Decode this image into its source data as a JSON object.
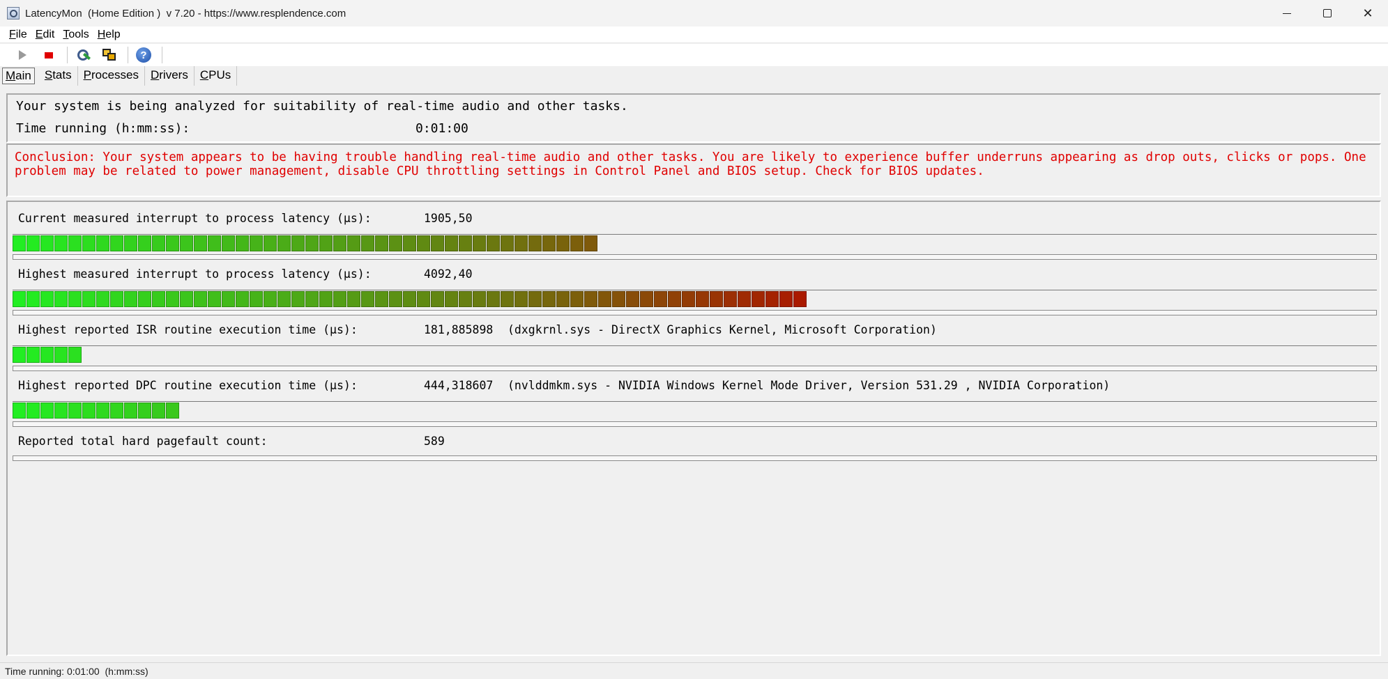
{
  "window": {
    "title": "LatencyMon  (Home Edition )  v 7.20 - https://www.resplendence.com",
    "minimize_icon": "minimize-icon",
    "maximize_icon": "maximize-icon",
    "close_glyph": "✕"
  },
  "menu": {
    "items": [
      "File",
      "Edit",
      "Tools",
      "Help"
    ]
  },
  "toolbar": {
    "icons": [
      "play-icon",
      "stop-icon",
      "wrench-icon",
      "windows-icon",
      "help-icon"
    ],
    "help_glyph": "?"
  },
  "tabs": {
    "items": [
      "Main",
      "Stats",
      "Processes",
      "Drivers",
      "CPUs"
    ],
    "active": "Main"
  },
  "analysis": {
    "status_line": "Your system is being analyzed for suitability of real-time audio and other tasks.",
    "time_label": "Time running (h:mm:ss):",
    "time_value": "0:01:00"
  },
  "conclusion": {
    "text": "Conclusion: Your system appears to be having trouble handling real-time audio and other tasks. You are likely to experience buffer underruns appearing as drop outs, clicks or pops. One problem may be related to power management, disable CPU throttling settings in Control Panel and BIOS setup. Check for BIOS updates.",
    "color": "#e00000"
  },
  "metrics": {
    "max_segments": 98,
    "items": [
      {
        "label": "Current measured interrupt to process latency (µs):",
        "value": "1905,50",
        "extra": "",
        "segments": 42
      },
      {
        "label": "Highest measured interrupt to process latency (µs):",
        "value": "4092,40",
        "extra": "",
        "segments": 57
      },
      {
        "label": "Highest reported ISR routine execution time (µs):",
        "value": "181,885898",
        "extra": "(dxgkrnl.sys - DirectX Graphics Kernel, Microsoft Corporation)",
        "segments": 5
      },
      {
        "label": "Highest reported DPC routine execution time (µs):",
        "value": "444,318607",
        "extra": "(nvlddmkm.sys - NVIDIA Windows Kernel Mode Driver, Version 531.29 , NVIDIA Corporation)",
        "segments": 12
      },
      {
        "label": "Reported total hard pagefault count:",
        "value": "589",
        "extra": "",
        "segments": 0
      }
    ]
  },
  "colors": {
    "meter_low": "#22ee22",
    "meter_mid": "#6a7a10",
    "meter_high": "#aa1a00"
  },
  "statusbar": {
    "text": "Time running: 0:01:00  (h:mm:ss)"
  }
}
